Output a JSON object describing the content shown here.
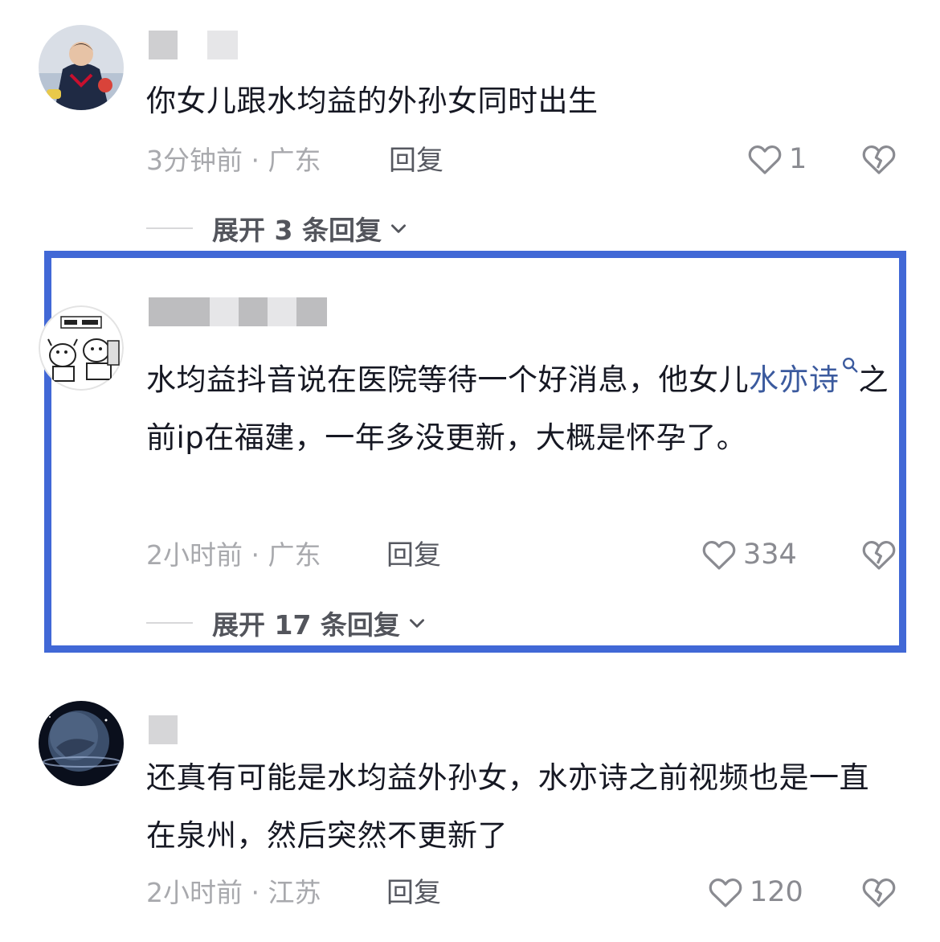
{
  "comments": [
    {
      "text": "你女儿跟水均益的外孙女同时出生",
      "meta": "3分钟前 · 广东",
      "reply_label": "回复",
      "likes": "1",
      "expand_label": "展开 3 条回复"
    },
    {
      "text_before_link": "水均益抖音说在医院等待一个好消息，他女儿",
      "link_text": "水亦诗",
      "text_after_link": "之前ip在福建，一年多没更新，大概是怀孕了。",
      "meta": "2小时前 · 广东",
      "reply_label": "回复",
      "likes": "334",
      "expand_label": "展开 17 条回复"
    },
    {
      "text": "还真有可能是水均益外孙女，水亦诗之前视频也是一直在泉州，然后突然不更新了",
      "meta": "2小时前 · 江苏",
      "reply_label": "回复",
      "likes": "120"
    }
  ],
  "colors": {
    "highlight_border": "#4168d6",
    "link": "#3b5a9e"
  },
  "icons": [
    "heart-icon",
    "broken-heart-icon",
    "search-icon",
    "chevron-down-icon"
  ]
}
